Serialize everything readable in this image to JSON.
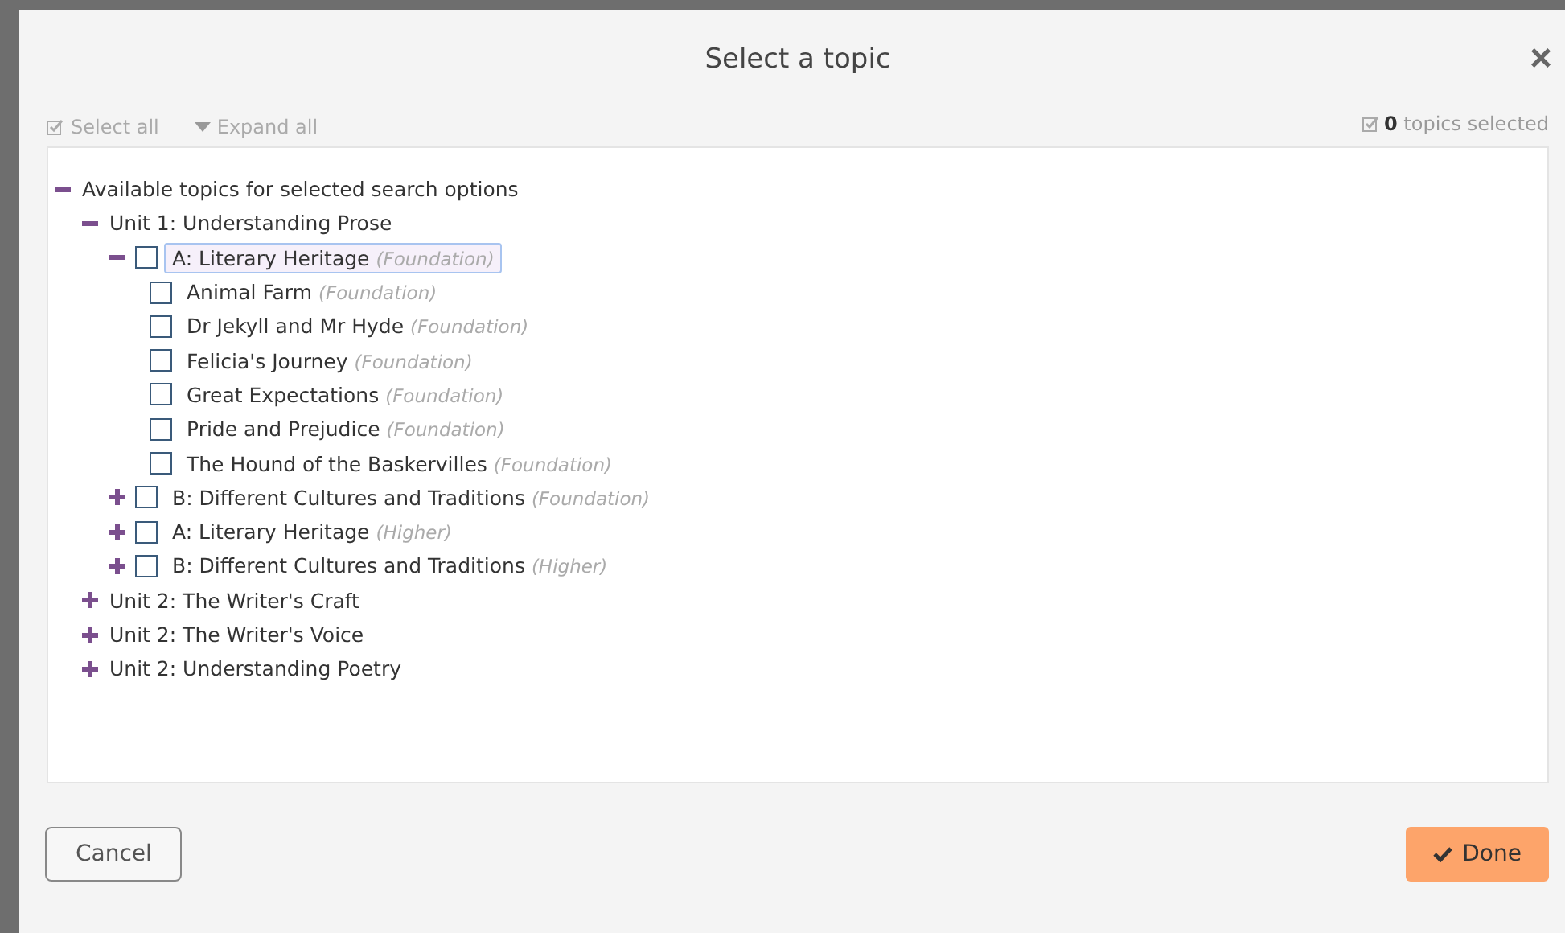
{
  "dialog": {
    "title": "Select a topic",
    "close": "×"
  },
  "toolbar": {
    "select_all": "Select all",
    "expand_all": "Expand all",
    "selected_count": "**0** topics selected"
  },
  "tree": [
    {
      "label": "Available topics for selected search options",
      "expanded": true,
      "selected": false,
      "children": [
        {
          "label": "Unit 1: Understanding Prose",
          "expanded": true,
          "selected": false,
          "children": [
            {
              "label": "A: Literary Heritage",
              "note": "(Foundation)",
              "expanded": true,
              "checked": false,
              "selected": true,
              "children": [
                {
                  "label": "Animal Farm",
                  "note": "(Foundation)",
                  "checked": false,
                  "selected": false
                },
                {
                  "label": "Dr Jekyll and Mr Hyde",
                  "note": "(Foundation)",
                  "checked": false,
                  "selected": false
                },
                {
                  "label": "Felicia's Journey",
                  "note": "(Foundation)",
                  "checked": false,
                  "selected": false
                },
                {
                  "label": "Great Expectations",
                  "note": "(Foundation)",
                  "checked": false,
                  "selected": false
                },
                {
                  "label": "Pride and Prejudice",
                  "note": "(Foundation)",
                  "checked": false,
                  "selected": false
                },
                {
                  "label": "The Hound of the Baskervilles",
                  "note": "(Foundation)",
                  "checked": false,
                  "selected": false
                }
              ]
            },
            {
              "label": "B: Different Cultures and Traditions",
              "note": "(Foundation)",
              "expanded": false,
              "checked": false,
              "selected": false
            },
            {
              "label": "A: Literary Heritage",
              "note": "(Higher)",
              "expanded": false,
              "checked": false,
              "selected": false
            },
            {
              "label": "B: Different Cultures and Traditions",
              "note": "(Higher)",
              "expanded": false,
              "checked": false,
              "selected": false
            }
          ]
        },
        {
          "label": "Unit 2: The Writer's Craft",
          "expanded": false,
          "selected": false
        },
        {
          "label": "Unit 2: The Writer's Voice",
          "expanded": false,
          "selected": false
        },
        {
          "label": "Unit 2: Understanding Poetry",
          "expanded": false,
          "selected": false
        }
      ]
    }
  ],
  "buttons": {
    "cancel": "Cancel",
    "done": "Done"
  }
}
